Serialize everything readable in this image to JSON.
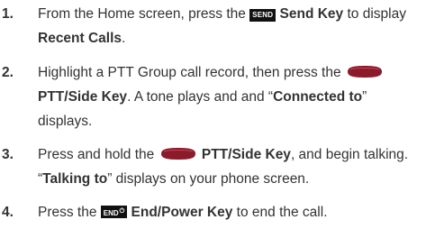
{
  "steps": [
    {
      "number": "1.",
      "l1_pre": "From the Home screen, press the ",
      "l1_key": "SEND",
      "l1_keyname": "Send Key",
      "l1_post": " to display",
      "l2_bold": "Recent Calls",
      "l2_post": "."
    },
    {
      "number": "2.",
      "l1_text": "Highlight a PTT Group call record, then press the",
      "l2_keyname": "PTT/Side Key",
      "l2_mid": ". A tone plays and and “",
      "l2_bold": "Connected to",
      "l2_post": "”",
      "l3_text": "displays."
    },
    {
      "number": "3.",
      "l1_pre": "Press and hold the ",
      "l1_keyname": "PTT/Side Key",
      "l1_post": ", and begin talking.",
      "l2_pre": "“",
      "l2_bold": "Talking to",
      "l2_post": "” displays on your phone screen."
    },
    {
      "number": "4.",
      "l1_pre": "Press the ",
      "l1_key": "END",
      "l1_key_symbol": "⏻",
      "l1_keyname": "End/Power Key",
      "l1_post": " to end the call."
    }
  ],
  "colors": {
    "text": "#333333",
    "key_bg": "#111111",
    "ptt_key": "#8b1a2b"
  },
  "icons": {
    "send_key": "send-key-icon",
    "end_key": "end-power-key-icon",
    "ptt_key": "ptt-side-key-icon"
  }
}
